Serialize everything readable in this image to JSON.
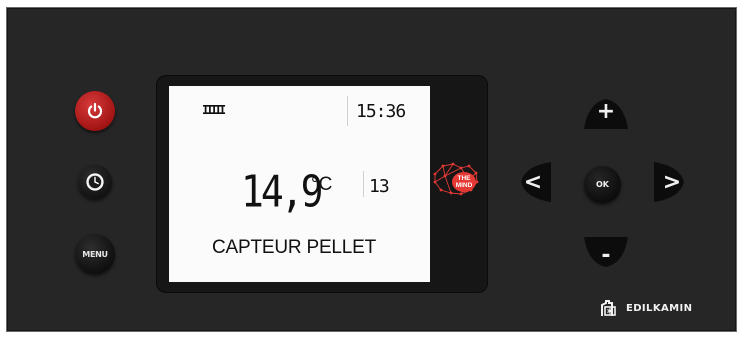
{
  "buttons": {
    "power_icon": "power-icon",
    "clock_icon": "clock-icon",
    "menu_label": "MENU"
  },
  "display": {
    "power_bars": "IIIII",
    "time": "15:36",
    "temperature": "14,9",
    "temperature_unit": "°C",
    "status_code": "13",
    "message": "CAPTEUR PELLET"
  },
  "mind_logo": {
    "line1": "THE",
    "line2": "MIND"
  },
  "navigation": {
    "up_label": "+",
    "down_label": "-",
    "left_label": "<",
    "right_label": ">",
    "ok_label": "OK"
  },
  "brand": {
    "name": "EDILKAMIN"
  },
  "colors": {
    "panel": "#262626",
    "power_button": "#b71c1c",
    "mind_logo": "#e53935",
    "lcd_background": "#fbfbfb"
  }
}
